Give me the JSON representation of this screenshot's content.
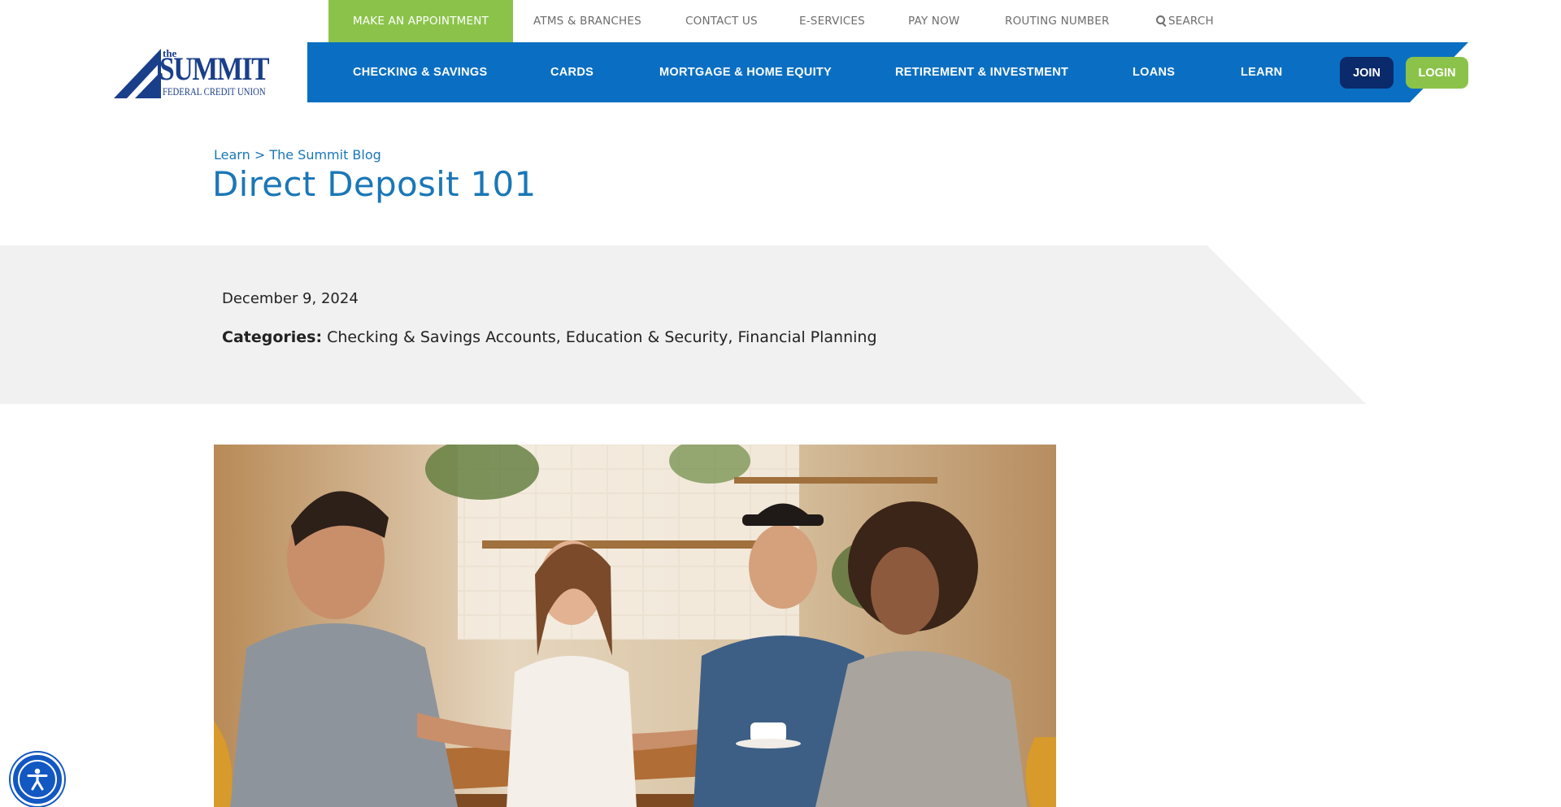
{
  "utility_nav": {
    "appointment": "MAKE AN APPOINTMENT",
    "atms": "ATMS & BRANCHES",
    "contact": "CONTACT US",
    "eservices": "E-SERVICES",
    "paynow": "PAY NOW",
    "routing": "ROUTING NUMBER",
    "search": "SEARCH"
  },
  "logo": {
    "the": "the",
    "name": "SUMMIT",
    "subtitle": "FEDERAL CREDIT UNION"
  },
  "main_nav": {
    "items": [
      "CHECKING & SAVINGS",
      "CARDS",
      "MORTGAGE & HOME EQUITY",
      "RETIREMENT & INVESTMENT",
      "LOANS",
      "LEARN"
    ],
    "join": "JOIN",
    "login": "LOGIN"
  },
  "breadcrumb": {
    "parent": "Learn",
    "separator": ">",
    "current": "The Summit Blog"
  },
  "page_title": "Direct Deposit 101",
  "meta": {
    "date": "December 9, 2024",
    "categories_label": "Categories:",
    "categories": [
      "Checking & Savings Accounts",
      "Education & Security",
      "Financial Planning"
    ]
  },
  "icons": {
    "search": "search-icon",
    "accessibility": "accessibility-icon"
  },
  "colors": {
    "brand_blue": "#0a6fc2",
    "accent_green": "#8bc34a",
    "navy": "#0b2a6b",
    "link_blue": "#1a77b7",
    "band_gray": "#f1f1f1"
  }
}
